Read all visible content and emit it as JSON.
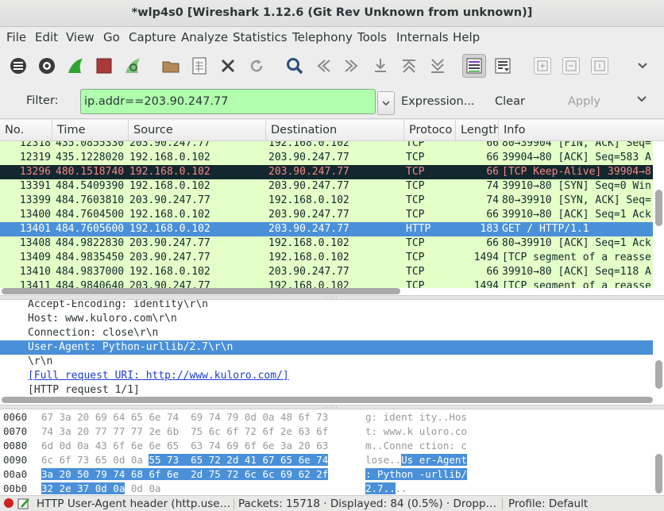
{
  "window": {
    "title": "*wlp4s0  [Wireshark 1.12.6  (Git Rev Unknown from unknown)]"
  },
  "menu": [
    "File",
    "Edit",
    "View",
    "Go",
    "Capture",
    "Analyze",
    "Statistics",
    "Telephony",
    "Tools",
    "Internals",
    "Help"
  ],
  "filter": {
    "label": "Filter:",
    "value": "ip.addr==203.90.247.77",
    "expression": "Expression...",
    "clear": "Clear",
    "apply": "Apply"
  },
  "colors": {
    "accent": "#4a90d9",
    "row_tcp": "#e4ffc7",
    "row_http": "#e4ffc7",
    "row_bad": "#12272e",
    "row_bad_text": "#f78787",
    "filter_ok": "#afffaf"
  },
  "columns": [
    "No.",
    "Time",
    "Source",
    "Destination",
    "Protoco",
    "Length",
    "Info"
  ],
  "packets": [
    {
      "no": "12318",
      "time": "435.0855330",
      "src": "203.90.247.77",
      "dst": "192.168.0.102",
      "proto": "TCP",
      "len": "66",
      "info": "80→39904 [FIN, ACK] Seq=",
      "style": "normal"
    },
    {
      "no": "12319",
      "time": "435.1228020",
      "src": "192.168.0.102",
      "dst": "203.90.247.77",
      "proto": "TCP",
      "len": "66",
      "info": "39904→80 [ACK] Seq=583 A",
      "style": "normal"
    },
    {
      "no": "13296",
      "time": "480.1518740",
      "src": "192.168.0.102",
      "dst": "203.90.247.77",
      "proto": "TCP",
      "len": "66",
      "info": "[TCP Keep-Alive] 39904→8",
      "style": "bad"
    },
    {
      "no": "13391",
      "time": "484.5409390",
      "src": "192.168.0.102",
      "dst": "203.90.247.77",
      "proto": "TCP",
      "len": "74",
      "info": "39910→80 [SYN] Seq=0 Win",
      "style": "normal"
    },
    {
      "no": "13399",
      "time": "484.7603810",
      "src": "203.90.247.77",
      "dst": "192.168.0.102",
      "proto": "TCP",
      "len": "74",
      "info": "80→39910 [SYN, ACK] Seq=",
      "style": "normal"
    },
    {
      "no": "13400",
      "time": "484.7604500",
      "src": "192.168.0.102",
      "dst": "203.90.247.77",
      "proto": "TCP",
      "len": "66",
      "info": "39910→80 [ACK] Seq=1 Ack",
      "style": "normal"
    },
    {
      "no": "13401",
      "time": "484.7605600",
      "src": "192.168.0.102",
      "dst": "203.90.247.77",
      "proto": "HTTP",
      "len": "183",
      "info": "GET / HTTP/1.1",
      "style": "selected"
    },
    {
      "no": "13408",
      "time": "484.9822830",
      "src": "203.90.247.77",
      "dst": "192.168.0.102",
      "proto": "TCP",
      "len": "66",
      "info": "80→39910 [ACK] Seq=1 Ack",
      "style": "normal"
    },
    {
      "no": "13409",
      "time": "484.9835450",
      "src": "203.90.247.77",
      "dst": "192.168.0.102",
      "proto": "TCP",
      "len": "1494",
      "info": "[TCP segment of a reasse",
      "style": "normal"
    },
    {
      "no": "13410",
      "time": "484.9837000",
      "src": "192.168.0.102",
      "dst": "203.90.247.77",
      "proto": "TCP",
      "len": "66",
      "info": "39910→80 [ACK] Seq=118 A",
      "style": "normal"
    },
    {
      "no": "13411",
      "time": "484.9840640",
      "src": "203.90.247.77",
      "dst": "192.168.0.102",
      "proto": "TCP",
      "len": "1494",
      "info": "[TCP segment of a reasse",
      "style": "normal"
    }
  ],
  "details": [
    {
      "text": "Accept-Encoding: identity\\r\\n",
      "style": "normal"
    },
    {
      "text": "Host: www.kuloro.com\\r\\n",
      "style": "normal"
    },
    {
      "text": "Connection: close\\r\\n",
      "style": "normal"
    },
    {
      "text": "User-Agent: Python-urllib/2.7\\r\\n",
      "style": "selected"
    },
    {
      "text": "\\r\\n",
      "style": "normal"
    },
    {
      "text": "[Full request URI: http://www.kuloro.com/]",
      "style": "link"
    },
    {
      "text": "[HTTP request 1/1]",
      "style": "normal"
    }
  ],
  "bytes": [
    {
      "offset": "0060",
      "hex_pre": "67 3a 20 69 64 65 6e 74  69 74 79 0d 0a 48 6f 73",
      "hex_sel": "",
      "hex_post": "",
      "ascii_pre": "g: ident ity..Hos",
      "ascii_sel": "",
      "ascii_post": ""
    },
    {
      "offset": "0070",
      "hex_pre": "74 3a 20 77 77 77 2e 6b  75 6c 6f 72 6f 2e 63 6f",
      "hex_sel": "",
      "hex_post": "",
      "ascii_pre": "t: www.k uloro.co",
      "ascii_sel": "",
      "ascii_post": ""
    },
    {
      "offset": "0080",
      "hex_pre": "6d 0d 0a 43 6f 6e 6e 65  63 74 69 6f 6e 3a 20 63",
      "hex_sel": "",
      "hex_post": "",
      "ascii_pre": "m..Conne ction: c",
      "ascii_sel": "",
      "ascii_post": ""
    },
    {
      "offset": "0090",
      "hex_pre": "6c 6f 73 65 0d 0a ",
      "hex_sel": "55 73  65 72 2d 41 67 65 6e 74",
      "hex_post": "",
      "ascii_pre": "lose..",
      "ascii_sel": "Us er-Agent",
      "ascii_post": ""
    },
    {
      "offset": "00a0",
      "hex_pre": "",
      "hex_sel": "3a 20 50 79 74 68 6f 6e  2d 75 72 6c 6c 69 62 2f",
      "hex_post": "",
      "ascii_pre": "",
      "ascii_sel": ": Python -urllib/",
      "ascii_post": ""
    },
    {
      "offset": "00b0",
      "hex_pre": "",
      "hex_sel": "32 2e 37 0d 0a",
      "hex_post": " 0d 0a",
      "ascii_pre": "",
      "ascii_sel": "2.7..",
      "ascii_post": ".."
    }
  ],
  "status": {
    "field": "HTTP User-Agent header (http.use…",
    "packets": "Packets: 15718 · Displayed: 84 (0.5%) · Dropp…",
    "profile": "Profile: Default"
  }
}
